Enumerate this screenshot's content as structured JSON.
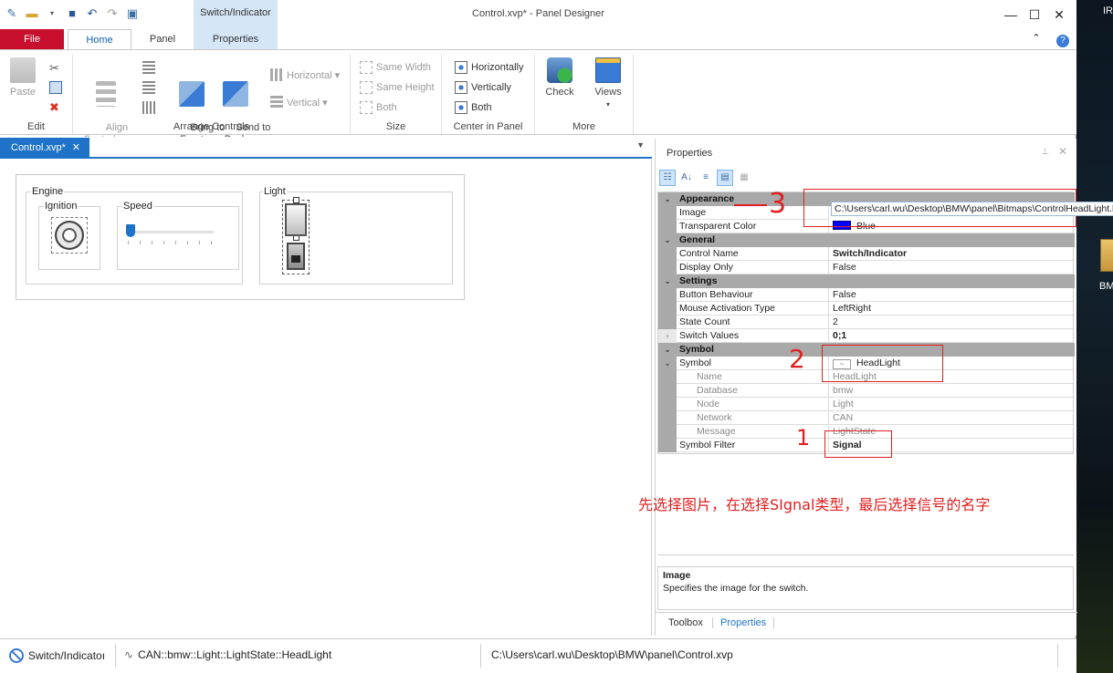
{
  "app": {
    "window_title": "Control.xvp* - Panel Designer",
    "context_tab_title": "Switch/Indicator"
  },
  "ribbon_tabs": {
    "file": "File",
    "home": "Home",
    "panel": "Panel",
    "properties": "Properties"
  },
  "ribbon": {
    "edit": {
      "group_label": "Edit",
      "paste": "Paste"
    },
    "arrange": {
      "group_label": "Arrange Controls",
      "align_controls": "Align\nControls ▾",
      "bring_to_front": "Bring to\nFront",
      "send_to_back": "Send to\nBack",
      "horizontal": "Horizontal ▾",
      "vertical": "Vertical ▾"
    },
    "size": {
      "group_label": "Size",
      "same_width": "Same Width",
      "same_height": "Same Height",
      "both": "Both"
    },
    "center": {
      "group_label": "Center in Panel",
      "horizontally": "Horizontally",
      "vertically": "Vertically",
      "both": "Both"
    },
    "more": {
      "group_label": "More",
      "check": "Check",
      "views": "Views"
    }
  },
  "document": {
    "tab_label": "Control.xvp*",
    "groups": {
      "engine": "Engine",
      "ignition": "Ignition",
      "speed": "Speed",
      "light": "Light"
    }
  },
  "properties_panel": {
    "title": "Properties",
    "categories": {
      "appearance": "Appearance",
      "general": "General",
      "settings": "Settings",
      "symbol": "Symbol"
    },
    "rows": {
      "image": {
        "name": "Image",
        "value": "C:\\Users\\carl.wu\\Desktop\\BMW\\panel\\Bitmaps\\ControlHeadLight.bmp"
      },
      "transparent_color": {
        "name": "Transparent Color",
        "value": "Blue"
      },
      "control_name": {
        "name": "Control Name",
        "value": "Switch/Indicator"
      },
      "display_only": {
        "name": "Display Only",
        "value": "False"
      },
      "button_behaviour": {
        "name": "Button Behaviour",
        "value": "False"
      },
      "mouse_activation": {
        "name": "Mouse Activation Type",
        "value": "LeftRight"
      },
      "state_count": {
        "name": "State Count",
        "value": "2"
      },
      "switch_values": {
        "name": "Switch Values",
        "value": "0;1"
      },
      "symbol": {
        "name": "Symbol",
        "value": "HeadLight"
      },
      "sym_name": {
        "name": "Name",
        "value": "HeadLight"
      },
      "sym_database": {
        "name": "Database",
        "value": "bmw"
      },
      "sym_node": {
        "name": "Node",
        "value": "Light"
      },
      "sym_network": {
        "name": "Network",
        "value": "CAN"
      },
      "sym_message": {
        "name": "Message",
        "value": "LightState"
      },
      "symbol_filter": {
        "name": "Symbol Filter",
        "value": "Signal"
      }
    },
    "description": {
      "title": "Image",
      "text": "Specifies the image for the switch."
    },
    "bottom_tabs": {
      "toolbox": "Toolbox",
      "properties": "Properties"
    }
  },
  "annotations": {
    "step1": "1",
    "step2": "2",
    "step3": "3",
    "note": "先选择图片，在选择SIgnal类型，最后选择信号的名字"
  },
  "statusbar": {
    "control": "Switch/Indicatoı",
    "symbol_path": "CAN::bmw::Light::LightState::HeadLight",
    "file_path": "C:\\Users\\carl.wu\\Desktop\\BMW\\panel\\Control.xvp"
  },
  "desktop": {
    "top_label": "IR",
    "icon_label": "BM"
  },
  "colors": {
    "file_tab": "#c8102e",
    "accent": "#1e73c9",
    "annotation": "#e02020",
    "transparent_swatch": "#0000ff"
  }
}
